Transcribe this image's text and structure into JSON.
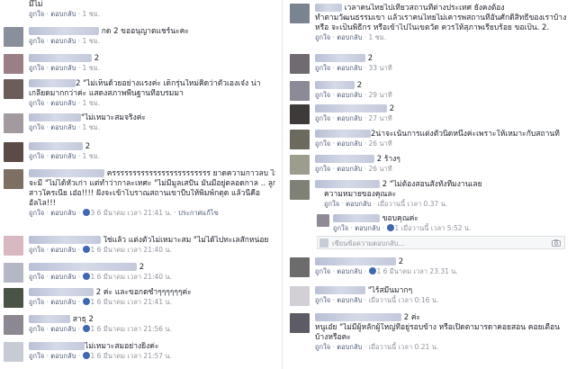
{
  "left": [
    {
      "l1": "มีไม่",
      "meta": [
        "ถูกใจ",
        "ตอบกลับ",
        "1 ชม."
      ]
    },
    {
      "l1": "กด 2 ขออนุญาตแชร์นะคะ",
      "meta": [
        "ถูกใจ",
        "ตอบกลับ",
        "1 ชม."
      ]
    },
    {
      "l1": "2",
      "meta": [
        "ถูกใจ",
        "ตอบกลับ",
        "1 ชม."
      ]
    },
    {
      "l1": "2 \"ไม่เห็นด้วยอย่างแรงค่ะ เด็กรุ่นใหม่คิดว่าตัวเองเจ๋ง น่า",
      "l2": "เกลียดมากกว่าค่ะ แสดงสภาพพื้นฐานที่อบรมมา",
      "meta": [
        "ถูกใจ",
        "ตอบกลับ",
        "1 ชม."
      ]
    },
    {
      "l1": "\"ไม่เหมาะสมจริงค่ะ",
      "meta": [
        "ถูกใจ",
        "ตอบกลับ",
        "1 ชม."
      ]
    },
    {
      "l1": "2",
      "meta": [
        "ถูกใจ",
        "ตอบกลับ",
        "1 ชม."
      ]
    },
    {
      "l1": "ครรรรรรรรรรรรรรรรรรรรรรรร ยาดความกาวลบ ไม่",
      "l2": "จะมี \"ไม่ได้หัวเก่า แต่ทำว่ากาละเทศะ \"ไม่มีมูลเสปัน มันมีอยู่ตลอดกาล .. ลูก",
      "l3": "สาวใครเนี่ย เอ๋อ!!!! ฝังจะเข้าโบราณสถานเขาบีบให้พิมพ์กตุด แล้วนี่คือ",
      "l4": "อัลไล!!!",
      "meta": [
        "ถูกใจ",
        "ตอบกลับ",
        "3",
        "6 มีนาคม เวลา 21:41 น.",
        "ประกาศแก้ไข"
      ]
    },
    {
      "l1": "ใช่แล้ว แต่งตัวไม่เหมาะสม \"ไม่ได้ไปทะเลสักหน่อย",
      "meta": [
        "ถูกใจ",
        "ตอบกลับ",
        "1",
        "6 มีนาคม เวลา 21:40 น."
      ]
    },
    {
      "l1": "2",
      "meta": [
        "ถูกใจ",
        "ตอบกลับ",
        "1",
        "6 มีนาคม เวลา 21:40 น."
      ]
    },
    {
      "l1": "2 ค่ะ และขอกดซ้ำๆๆๆๆๆๆค่ะ",
      "meta": [
        "ถูกใจ",
        "ตอบกลับ",
        "1",
        "6 มีนาคม เวลา 21:41 น."
      ]
    },
    {
      "l1": "สาธุ 2",
      "meta": [
        "ถูกใจ",
        "ตอบกลับ",
        "1",
        "6 มีนาคม เวลา 21:56 น."
      ]
    },
    {
      "l1": "ไม่เหมาะสมอย่างยิ่งค่ะ",
      "meta": [
        "ถูกใจ",
        "ตอบกลับ",
        "1",
        "6 มีนาคม เวลา 21:57 น."
      ]
    }
  ],
  "right": [
    {
      "l1": "เวลาคนไทยไปเที่ยวสถานที่ต่างประเทศ ยังคงต้อง",
      "l2": "ทำตามวัฒนธรรมเขา แล้วเราคนไทยไม่เคารพสถานที่อันศักดิ์สิทธิ์ของเราบ้าง",
      "l3": "หรือ จะเป็นพิธีกร หรือเข้าไปในเขตวัด ควรให้สุภาพเรียบร้อย ขอเป็น. 2.",
      "meta": [
        "ถูกใจ",
        "ตอบกลับ",
        "1 ชม."
      ]
    },
    {
      "l1": "2",
      "meta": [
        "ถูกใจ",
        "ตอบกลับ",
        "33 นาที"
      ]
    },
    {
      "l1": "2",
      "meta": [
        "ถูกใจ",
        "ตอบกลับ",
        "29 นาที"
      ]
    },
    {
      "l1": "2",
      "meta": [
        "ถูกใจ",
        "ตอบกลับ",
        "27 นาที"
      ]
    },
    {
      "l1": "2น่าจะเน้นการแต่งตัวนิดหนึ่งค่ะเพราะให้เหมาะกับสถานที่",
      "meta": [
        "ถูกใจ",
        "ตอบกลับ",
        "26 นาที"
      ]
    },
    {
      "l1": "2 ร้างๆ",
      "meta": [
        "ถูกใจ",
        "ตอบกลับ",
        "26 นาที"
      ]
    },
    {
      "l1": "2 \"ไม่ต้องสอนสั่งทั้งที่มงานเลย",
      "meta": [
        "ถูกใจ",
        "ตอบกลับ",
        "เมื่อวานนี้ เวลา 0.37 น."
      ],
      "rep": "ความหมายของคุณละ"
    },
    {
      "l1": "ขอบคุณค่ะ",
      "meta": [
        "ถูกใจ",
        "ตอบกลับ",
        "1",
        "เมื่อวานนี้ เวลา 5:52 น."
      ]
    },
    {
      "l1": "2",
      "meta": [
        "ถูกใจ",
        "ตอบกลับ",
        "1",
        "6 มีนาคม เวลา 23.31 น."
      ]
    },
    {
      "l1": "\"ไร้สมีนมากๆ",
      "meta": [
        "ถูกใจ",
        "ตอบกลับ",
        "เมื่อวานนี้ เวลา 0:16 น."
      ]
    },
    {
      "l1": "2 ค่ะ",
      "l2": "หนูเอ๋ย \"ไม่มีผู้หลักผู้ใหญ่ที่อยู่รอบข้าง หรือเปิดตามารดาคอยสอน คอยเตือน",
      "l3": "บ้างหรือคะ",
      "meta": [
        "ถูกใจ",
        "ตอบกลับ",
        "เมื่อวานนี้ เวลา 0.21 น."
      ]
    }
  ],
  "reply_placeholder": "เขียนข้อความตอบกลับ...",
  "colors": {
    "link": "#4b5875",
    "meta": "#90949c",
    "badge": "#4267b2",
    "divider": "#e4e6eb"
  }
}
